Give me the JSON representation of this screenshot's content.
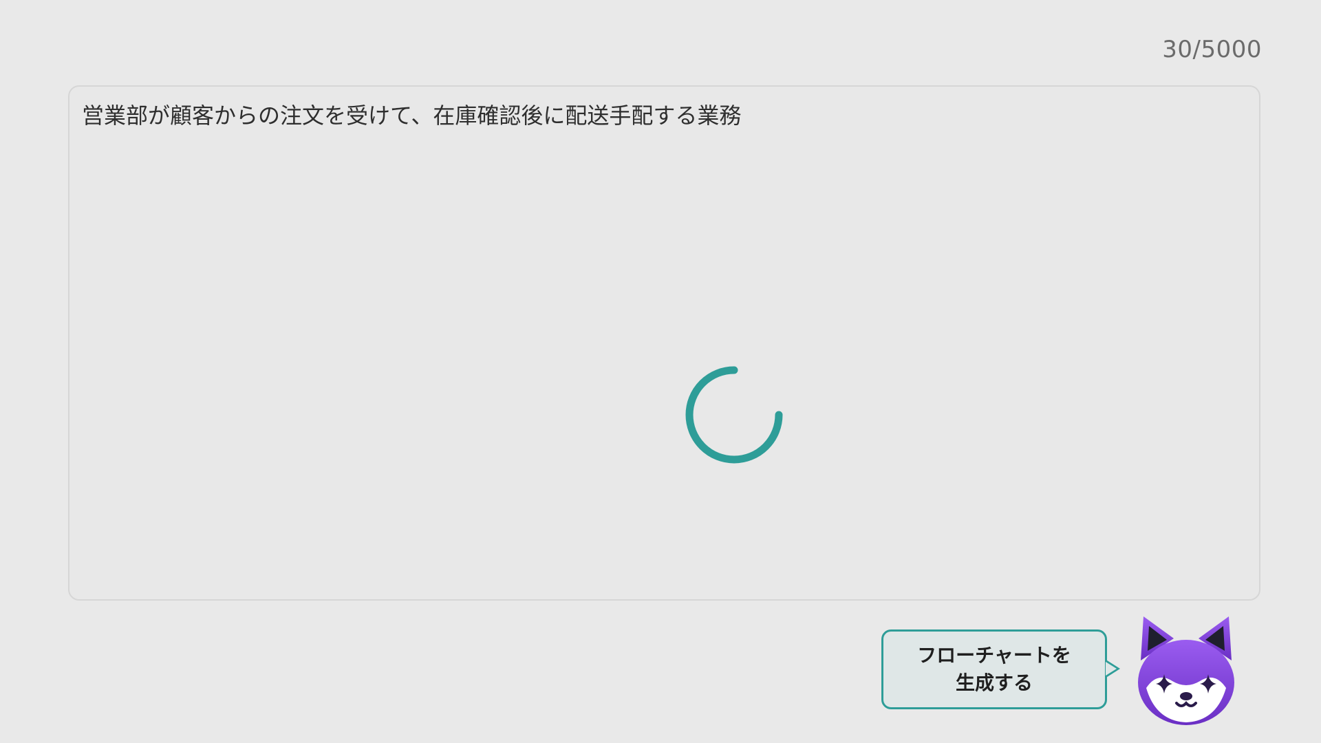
{
  "counter": {
    "text": "30/5000"
  },
  "editor": {
    "value": "営業部が顧客からの注文を受けて、在庫確認後に配送手配する業務"
  },
  "loading": {
    "icon": "loading-spinner-icon",
    "color": "#2e9d98"
  },
  "generate_button": {
    "label": "フローチャートを生成する"
  },
  "mascot": {
    "icon": "fox-mascot-icon",
    "colors": {
      "face": "#7e3fd6",
      "ears": "#1f1f2e",
      "muzzle": "#ffffff"
    }
  }
}
